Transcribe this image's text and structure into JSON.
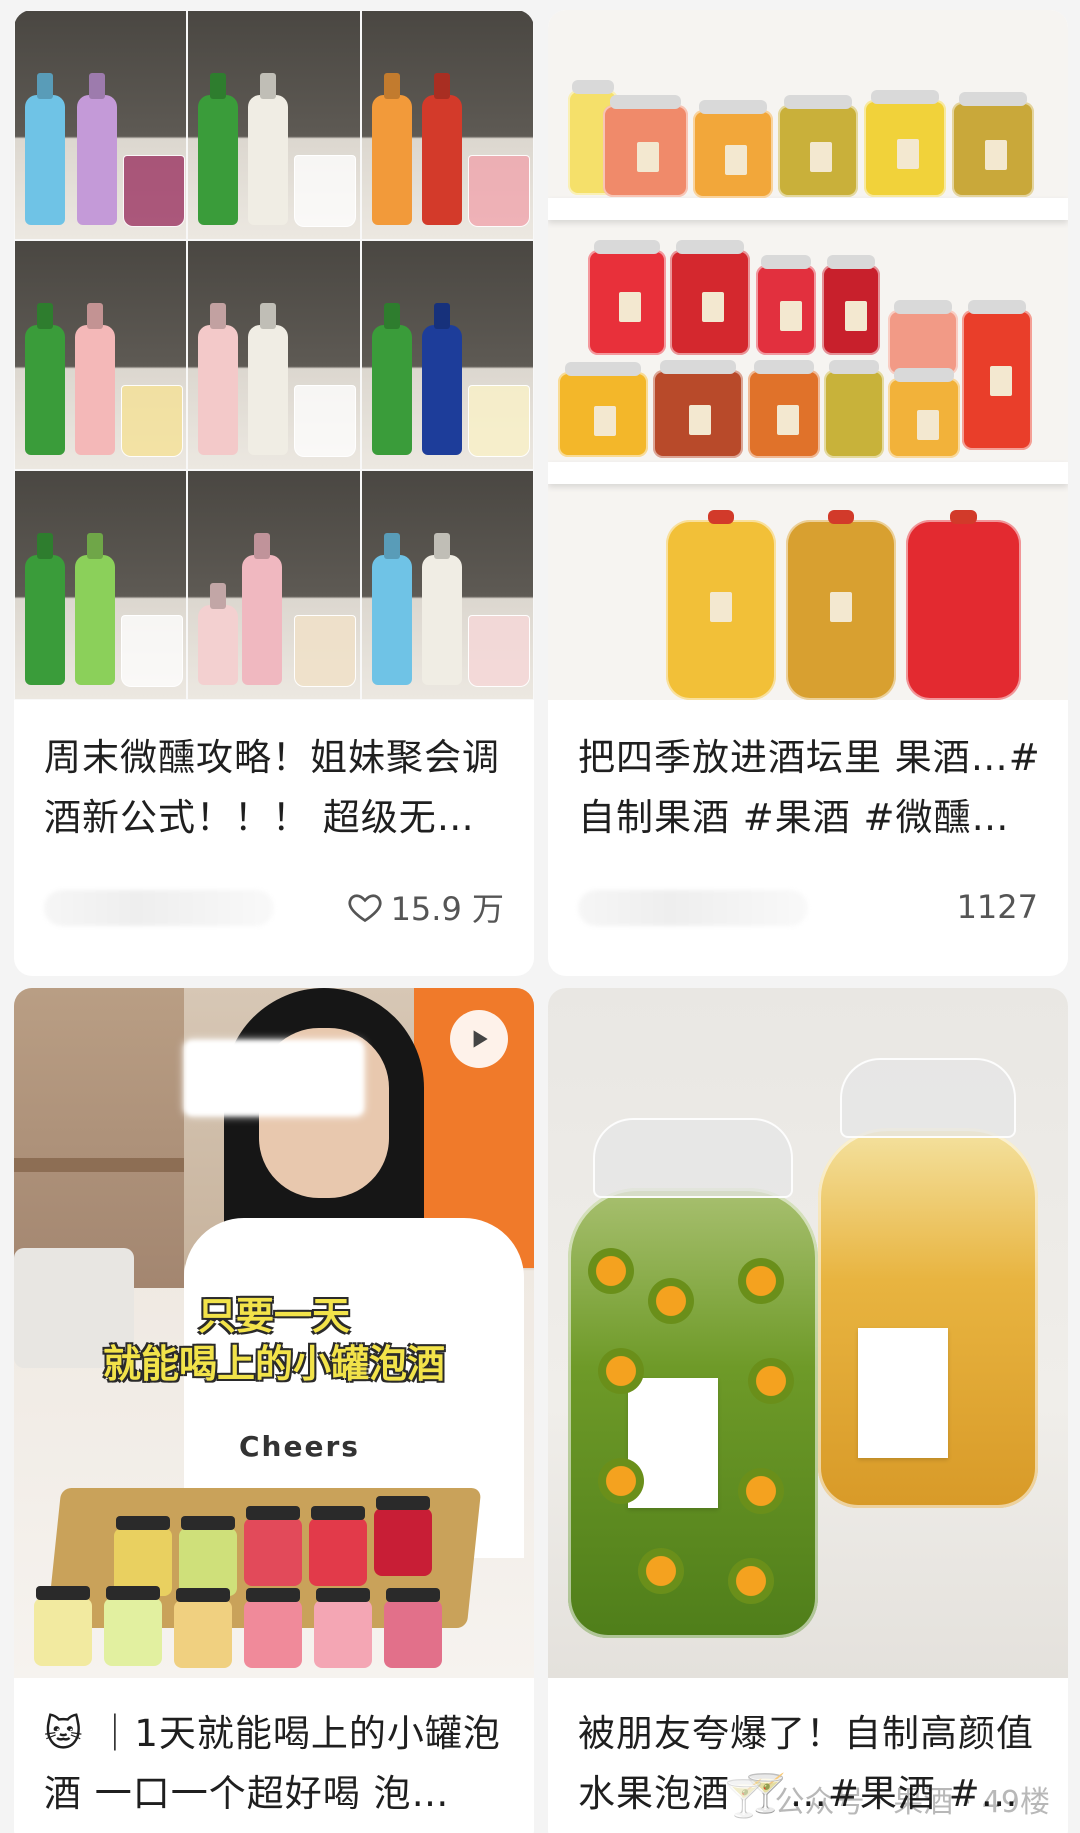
{
  "feed": {
    "cards": [
      {
        "title": "周末微醺攻略！姐妹聚会调酒新公式！！！ 超级无…",
        "likes": "15.9 万",
        "like_icon": "heart-outline-icon"
      },
      {
        "title": "把四季放进酒坛里 果酒…#自制果酒 #果酒 #微醺…",
        "likes": "1127"
      },
      {
        "title": "🐱 ｜1天就能喝上的小罐泡酒 一口一个超好喝 泡…",
        "video_caption_line1": "只要一天",
        "video_caption_line2": "就能喝上的小罐泡酒",
        "play_icon": "play-icon",
        "shirt_text": "Cheers"
      },
      {
        "title": "被朋友夸爆了！自制高颜值水果泡酒 🍸…#果酒 #…"
      }
    ],
    "watermark": {
      "text": "公众号 · 果酒 · 49楼",
      "icon": "cocktail-icon"
    }
  },
  "colors": {
    "background": "#f4f4f4",
    "card": "#ffffff",
    "caption_yellow": "#f2e34a"
  }
}
